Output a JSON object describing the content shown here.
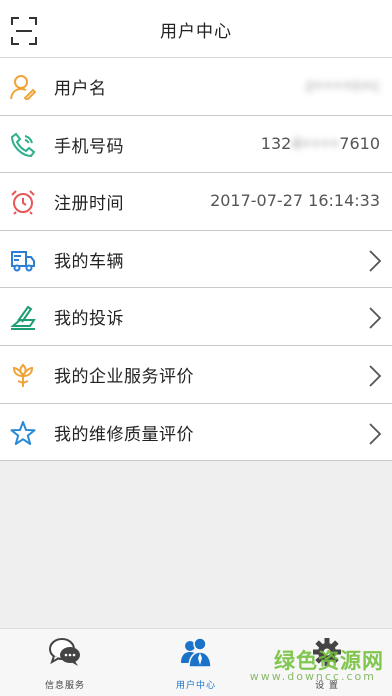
{
  "header": {
    "title": "用户中心",
    "scan_icon": "scan-icon"
  },
  "rows": [
    {
      "id": "username",
      "label": "用户名",
      "value": "z••••n•c",
      "icon": "user-pen-icon",
      "color": "#f0a43a"
    },
    {
      "id": "phone",
      "label": "手机号码",
      "value_prefix": "132",
      "value_blur": "4••••",
      "value_suffix": "7610",
      "icon": "phone-icon",
      "color": "#2fae8c"
    },
    {
      "id": "register_time",
      "label": "注册时间",
      "value": "2017-07-27 16:14:33",
      "icon": "alarm-clock-icon",
      "color": "#e8565a"
    },
    {
      "id": "vehicles",
      "label": "我的车辆",
      "icon": "truck-icon",
      "color": "#2a7fd4"
    },
    {
      "id": "complaints",
      "label": "我的投诉",
      "icon": "pen-paper-icon",
      "color": "#1e9e72"
    },
    {
      "id": "enterprise_review",
      "label": "我的企业服务评价",
      "icon": "flower-icon",
      "color": "#f0a43a"
    },
    {
      "id": "repair_review",
      "label": "我的维修质量评价",
      "icon": "star-icon",
      "color": "#2a8ad4"
    }
  ],
  "tabs": [
    {
      "label": "信息服务",
      "icon": "chat-icon"
    },
    {
      "label": "用户中心",
      "icon": "users-icon",
      "active": true
    },
    {
      "label": "设  置",
      "icon": "gear-icon"
    }
  ],
  "watermark": {
    "text": "绿色资源网",
    "sub": "www.downcc.com"
  }
}
